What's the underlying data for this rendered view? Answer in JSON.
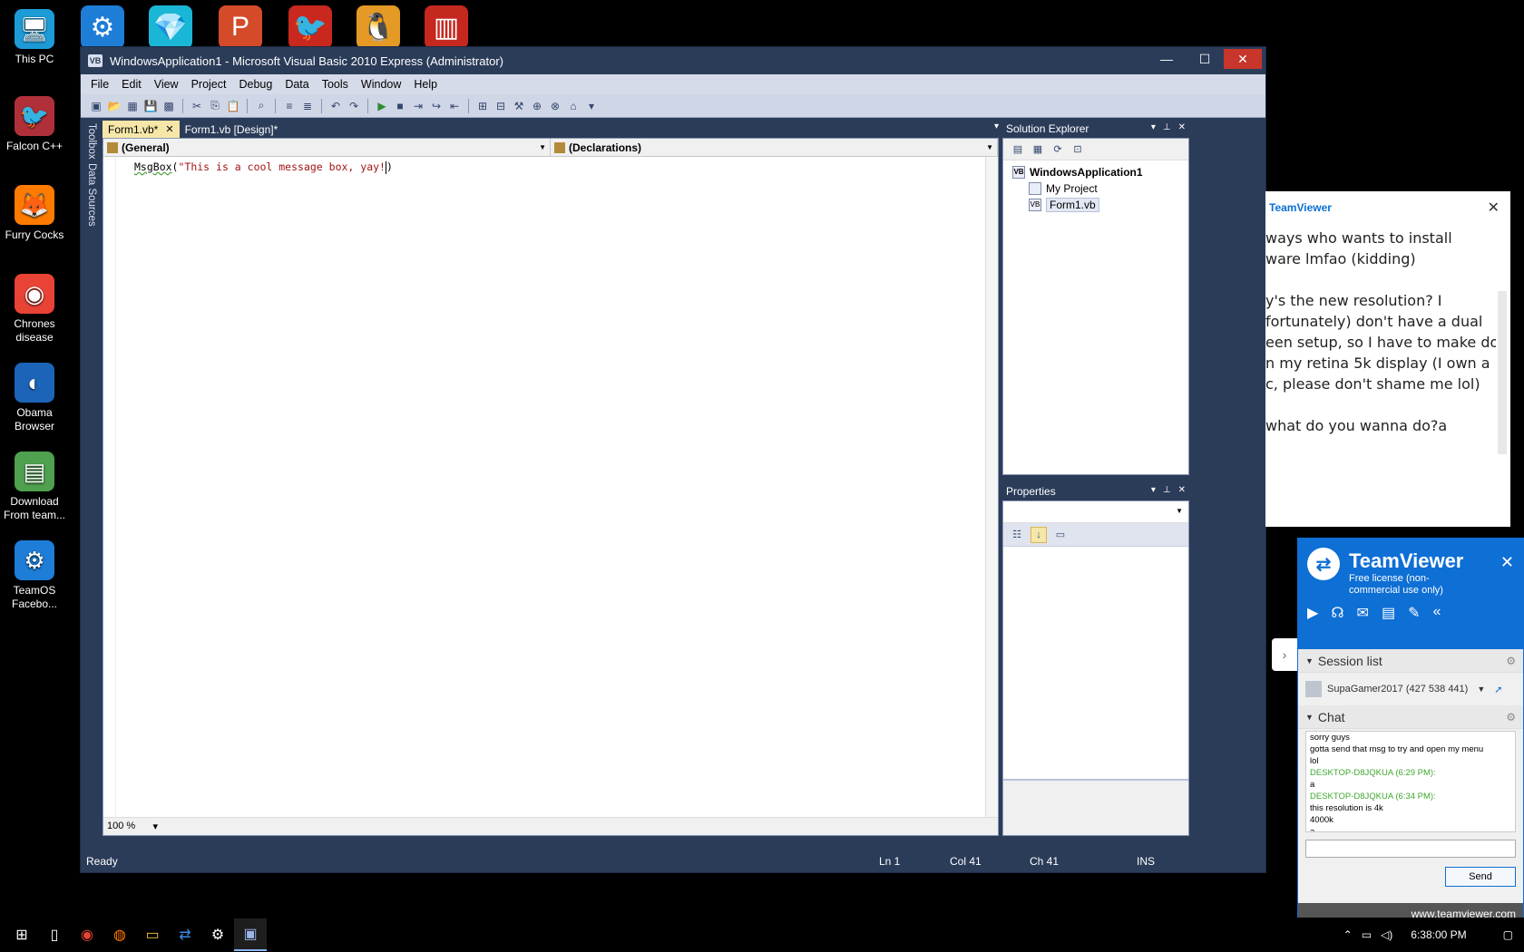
{
  "desktop": {
    "left_icons": [
      {
        "label": "This PC",
        "glyph": "🖥",
        "color": "#1d9bd7"
      },
      {
        "label": "Falcon C++",
        "glyph": "🐦",
        "color": "#b0303a"
      },
      {
        "label": "Furry Cocks",
        "glyph": "🦊",
        "color": "#ff7b00"
      },
      {
        "label": "Chrones disease",
        "glyph": "◉",
        "color": "#e84335"
      },
      {
        "label": "Obama Browser",
        "glyph": "◐",
        "color": "#1b64b8"
      },
      {
        "label": "Download From team...",
        "glyph": "▤",
        "color": "#4fa04f"
      },
      {
        "label": "TeamOS Facebo...",
        "glyph": "⚙",
        "color": "#1d7dd7"
      }
    ],
    "top_icons": [
      {
        "glyph": "⚙",
        "color": "#1d7dd7"
      },
      {
        "glyph": "💎",
        "color": "#1ab6d6"
      },
      {
        "glyph": "P",
        "color": "#d44b2a"
      },
      {
        "glyph": "🐦",
        "color": "#c8281e"
      },
      {
        "glyph": "🐧",
        "color": "#e49a24"
      },
      {
        "glyph": "▥",
        "color": "#c5281f"
      }
    ]
  },
  "vs": {
    "title": "WindowsApplication1 - Microsoft Visual Basic 2010 Express (Administrator)",
    "logo": "VB",
    "menu": [
      "File",
      "Edit",
      "View",
      "Project",
      "Debug",
      "Data",
      "Tools",
      "Window",
      "Help"
    ],
    "side_labels": [
      "Toolbox",
      "Data Sources"
    ],
    "tabs": [
      {
        "label": "Form1.vb*",
        "active": true
      },
      {
        "label": "Form1.vb [Design]*",
        "active": false
      }
    ],
    "nav_left": "(General)",
    "nav_right": "(Declarations)",
    "code": {
      "ident": "MsgBox",
      "open": "(",
      "string": "\"This is a cool message box, yay!",
      "close": ")"
    },
    "zoom": "100 %",
    "status": {
      "ready": "Ready",
      "ln": "Ln 1",
      "col": "Col 41",
      "ch": "Ch 41",
      "ins": "INS"
    },
    "solution_explorer": {
      "title": "Solution Explorer",
      "root": "WindowsApplication1",
      "items": [
        "My Project",
        "Form1.vb"
      ]
    },
    "properties": {
      "title": "Properties"
    }
  },
  "teamviewer_chat": {
    "title": "TeamViewer",
    "messages": [
      "ways who wants to install",
      "ware lmfao (kidding)",
      "y's the new resolution? I",
      "fortunately) don't have a dual",
      "een setup, so I have to make do",
      "n my retina 5k display (I own a",
      "c, please don't shame me lol)",
      "what do you wanna do?a"
    ]
  },
  "teamviewer": {
    "name": "TeamViewer",
    "license": "Free license (non-commercial use only)",
    "session_list": "Session list",
    "session": "SupaGamer2017 (427 538 441)",
    "chat_label": "Chat",
    "chat_lines": [
      {
        "text": "sorry guys",
        "green": false
      },
      {
        "text": "gotta send that msg to try and open my menu",
        "green": false
      },
      {
        "text": "lol",
        "green": false
      },
      {
        "text": "DESKTOP-D8JQKUA (6:29 PM):",
        "green": true
      },
      {
        "text": "a",
        "green": false
      },
      {
        "text": "DESKTOP-D8JQKUA (6:34 PM):",
        "green": true
      },
      {
        "text": "this resolution is 4k",
        "green": false
      },
      {
        "text": "4000k",
        "green": false
      },
      {
        "text": "a",
        "green": false
      }
    ],
    "send": "Send",
    "link": "www.teamviewer.com"
  },
  "taskbar": {
    "time": "6:38:00 PM"
  }
}
